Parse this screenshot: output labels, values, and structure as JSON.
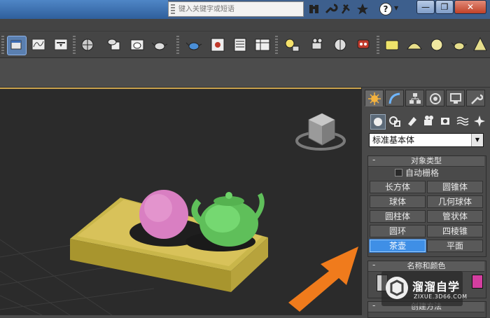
{
  "search": {
    "placeholder": "键入关键字或短语"
  },
  "titlebar": {
    "icons": [
      "binoculars-icon",
      "wrench-icon",
      "pin-icon",
      "star-icon",
      "help-icon"
    ],
    "help_label": "?",
    "window_controls": {
      "minimize": "—",
      "restore": "❐",
      "close": "✕"
    }
  },
  "toolbar": {
    "icons": [
      "select-object-icon",
      "curve-editor-icon",
      "dope-sheet-icon",
      "material-editor-icon",
      "render-setup-icon",
      "rendered-frame-icon",
      "render-teapot-icon",
      "render-quick-icon",
      "teapot-icon",
      "render-frame-window-icon",
      "layer-manager-icon",
      "scene-explorer-icon",
      "light-icon",
      "keyboard-icon",
      "camera-icon",
      "audio-icon",
      "robot-icon",
      "plane-icon",
      "dome-icon",
      "sphere-light-icon",
      "teapot-small-icon",
      "cone-icon"
    ]
  },
  "command_panel": {
    "tabs": [
      "create-tab",
      "modify-tab",
      "hierarchy-tab",
      "motion-tab",
      "display-tab",
      "utilities-tab"
    ],
    "subcategories": [
      "geometry-icon",
      "shapes-icon",
      "lights-icon",
      "cameras-icon",
      "helpers-icon",
      "space-warps-icon",
      "systems-icon"
    ],
    "category": "标准基本体",
    "object_type": {
      "header": "对象类型",
      "collapse": "-",
      "autogrid": "自动栅格",
      "buttons": [
        "长方体",
        "圆锥体",
        "球体",
        "几何球体",
        "圆柱体",
        "管状体",
        "圆环",
        "四棱锥",
        "茶壶",
        "平面"
      ],
      "active": "茶壶"
    },
    "name_color": {
      "header": "名称和颜色",
      "collapse": "-",
      "swatch": "#d43ea0"
    },
    "creation_method": {
      "header": "创建方法",
      "collapse": "-"
    }
  },
  "colors": {
    "accent_blue": "#3f8fe6",
    "viewport_border": "#c9a34d",
    "arrow": "#f07b1c",
    "box": "#d8c25a",
    "sphere": "#d97fc2",
    "teapot": "#6fd36a"
  },
  "watermark": {
    "name": "溜溜自学",
    "url": "ZIXUE.3D66.COM"
  }
}
